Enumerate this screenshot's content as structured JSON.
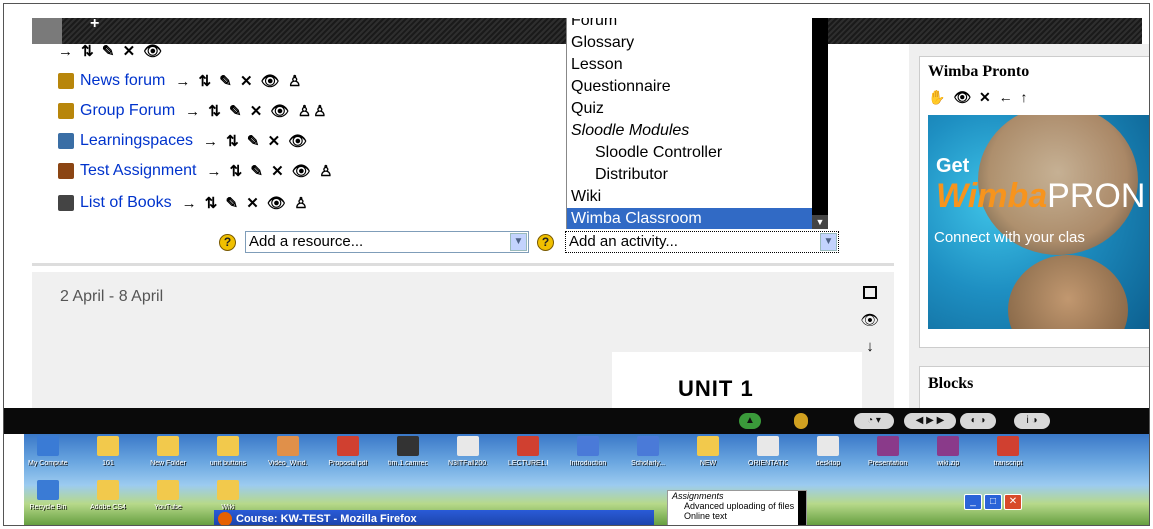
{
  "activities": [
    {
      "icon": "forum-icon",
      "label": "News forum",
      "tools": "→ ⇅ ✎ ✕ 👁 ♙"
    },
    {
      "icon": "forum-icon",
      "label": "Group Forum",
      "tools": "→ ⇅ ✎ ✕ 👁 ♙♙"
    },
    {
      "icon": "document-icon",
      "label": "Learningspaces",
      "tools": "→ ⇅ ✎ ✕ 👁"
    },
    {
      "icon": "assignment-icon",
      "label": "Test Assignment",
      "tools": "→ ⇅ ✎ ✕ 👁 ♙"
    },
    {
      "icon": "books-icon",
      "label": "List of Books",
      "tools": "→ ⇅ ✎ ✕ 👁 ♙"
    }
  ],
  "top_tools": "→ ⇅ ✎ ✕ 👁",
  "add_resource": {
    "value": "Add a resource..."
  },
  "add_activity": {
    "value": "Add an activity..."
  },
  "help_glyph": "?",
  "dropdown": {
    "items": [
      {
        "label": "Forum",
        "kind": "opt"
      },
      {
        "label": "Glossary",
        "kind": "opt"
      },
      {
        "label": "Lesson",
        "kind": "opt"
      },
      {
        "label": "Questionnaire",
        "kind": "opt"
      },
      {
        "label": "Quiz",
        "kind": "opt"
      },
      {
        "label": "Sloodle Modules",
        "kind": "group"
      },
      {
        "label": "Sloodle Controller",
        "kind": "sub"
      },
      {
        "label": "Distributor",
        "kind": "sub"
      },
      {
        "label": "Wiki",
        "kind": "opt"
      },
      {
        "label": "Wimba Classroom",
        "kind": "selected"
      }
    ]
  },
  "section2": {
    "date": "2 April - 8 April",
    "unit_title": "UNIT 1"
  },
  "wimba_block": {
    "title": "Wimba Pronto",
    "icons": "✋ 👁 ✕ ← ↑",
    "banner_get": "Get",
    "banner_brand": "Wimba",
    "banner_brand_suffix": "PRON",
    "banner_tagline": "Connect with your clas"
  },
  "blocks_block": {
    "title": "Blocks"
  },
  "desktop_icons_row1": [
    "My Computer",
    "101",
    "New Folder",
    "unit buttons",
    "Video_Wind...",
    "Proposal.pdf",
    "tim.1.camrec",
    "N3ITFall200...",
    "LECTURE1.PPT",
    "Introduction",
    "Scholarly...",
    "NEW",
    "ORIENTATION",
    "desktop",
    "Presentations",
    "wiki.zip",
    "transcript"
  ],
  "desktop_icons_row2": [
    "Recycle Bin",
    "Adobe CS4",
    "YouTube",
    "Wiki"
  ],
  "taskbar": {
    "firefox_title": "Course: KW-TEST - Mozilla Firefox"
  },
  "assignments_popup": {
    "group": "Assignments",
    "items": [
      "Advanced uploading of files",
      "Online text"
    ]
  },
  "colors": {
    "link": "#0033cc",
    "selected": "#316ac5",
    "brand_orange": "#f7941d"
  }
}
